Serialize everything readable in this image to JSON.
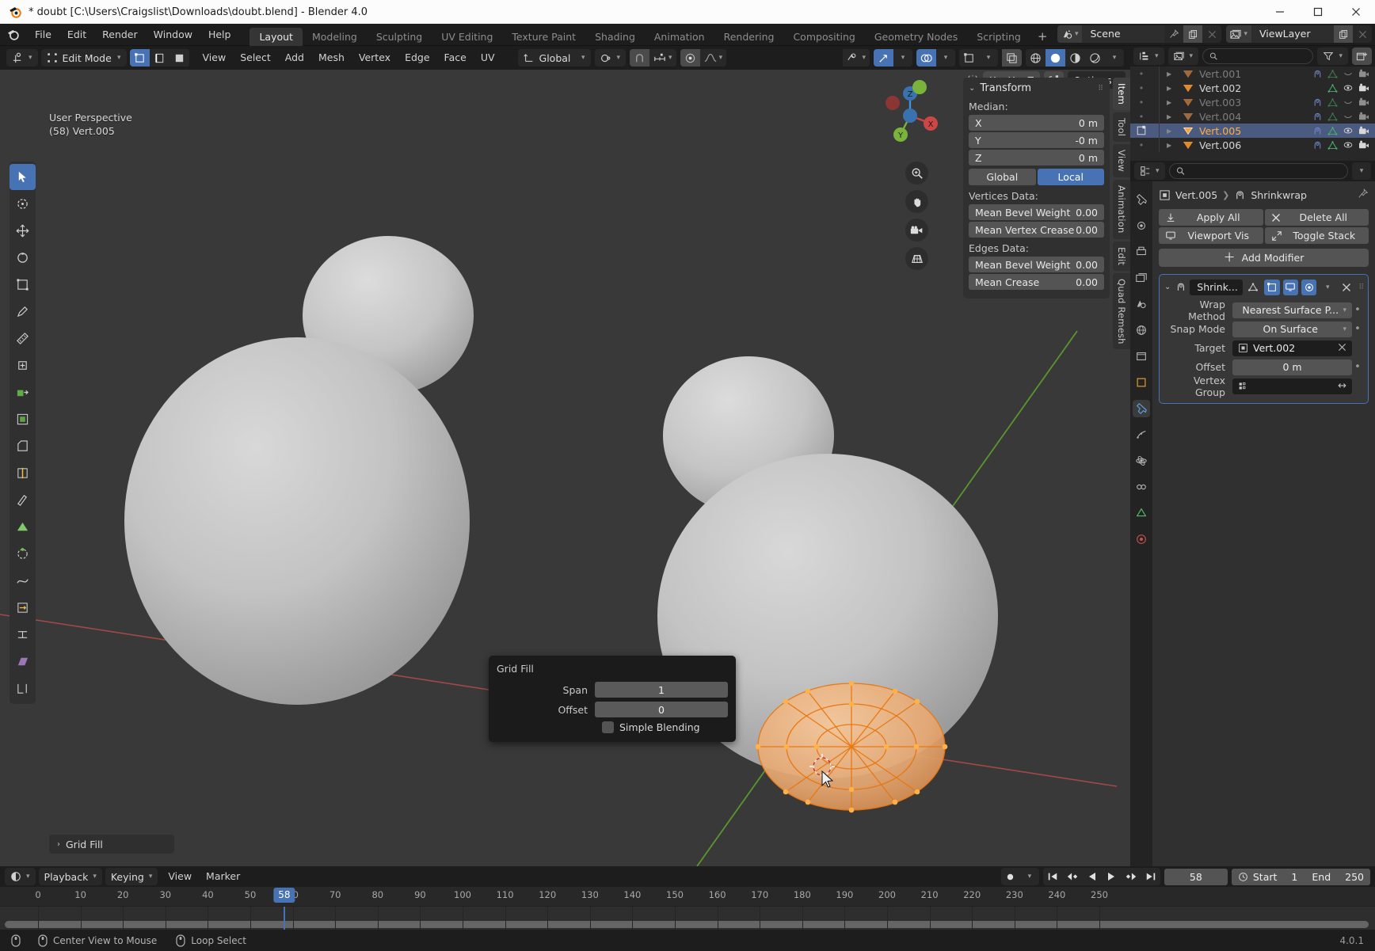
{
  "window": {
    "title": "* doubt [C:\\Users\\Craigslist\\Downloads\\doubt.blend] - Blender 4.0",
    "minimize": "–",
    "maximize": "▢",
    "close": "✕"
  },
  "topbar": {
    "menus": [
      "File",
      "Edit",
      "Render",
      "Window",
      "Help"
    ],
    "workspaces": [
      {
        "label": "Layout",
        "active": true
      },
      {
        "label": "Modeling",
        "active": false
      },
      {
        "label": "Sculpting",
        "active": false
      },
      {
        "label": "UV Editing",
        "active": false
      },
      {
        "label": "Texture Paint",
        "active": false
      },
      {
        "label": "Shading",
        "active": false
      },
      {
        "label": "Animation",
        "active": false
      },
      {
        "label": "Rendering",
        "active": false
      },
      {
        "label": "Compositing",
        "active": false
      },
      {
        "label": "Geometry Nodes",
        "active": false
      },
      {
        "label": "Scripting",
        "active": false
      }
    ],
    "add_workspace": "+",
    "scene_name": "Scene",
    "viewlayer_name": "ViewLayer"
  },
  "viewport": {
    "mode": "Edit Mode",
    "menus": [
      "View",
      "Select",
      "Add",
      "Mesh",
      "Vertex",
      "Edge",
      "Face",
      "UV"
    ],
    "transform_orientation": "Global",
    "options_label": "Options",
    "axis_buttons": [
      "X",
      "Y",
      "Z"
    ],
    "overlay_text_line1": "User Perspective",
    "overlay_text_line2": "(58) Vert.005",
    "gizmo_axes": [
      "X",
      "Y",
      "Z"
    ],
    "operator_panel_label": "Grid Fill"
  },
  "npanel": {
    "tab_active": "Item",
    "tabs": [
      "Item",
      "Tool",
      "View",
      "Animation",
      "Edit",
      "Quad Remesh"
    ],
    "title": "Transform",
    "median_label": "Median:",
    "median": [
      {
        "axis": "X",
        "value": "0 m"
      },
      {
        "axis": "Y",
        "value": "-0 m"
      },
      {
        "axis": "Z",
        "value": "0 m"
      }
    ],
    "space_global": "Global",
    "space_local": "Local",
    "space_active": "Local",
    "vertices_data_label": "Vertices Data:",
    "vertices_data": [
      {
        "label": "Mean Bevel Weight",
        "value": "0.00"
      },
      {
        "label": "Mean Vertex Crease",
        "value": "0.00"
      }
    ],
    "edges_data_label": "Edges Data:",
    "edges_data": [
      {
        "label": "Mean Bevel Weight",
        "value": "0.00"
      },
      {
        "label": "Mean Crease",
        "value": "0.00"
      }
    ]
  },
  "gridfill": {
    "title": "Grid Fill",
    "span_label": "Span",
    "span_value": "1",
    "offset_label": "Offset",
    "offset_value": "0",
    "simple_blending_label": "Simple Blending",
    "simple_blending_checked": false
  },
  "outliner": {
    "search_placeholder": "",
    "rows": [
      {
        "name": "Vert.001",
        "dim": true,
        "selected": false,
        "has_wrench": true,
        "eye": "closed",
        "camera": true
      },
      {
        "name": "Vert.002",
        "dim": false,
        "selected": false,
        "has_wrench": false,
        "eye": "open",
        "camera": true
      },
      {
        "name": "Vert.003",
        "dim": true,
        "selected": false,
        "has_wrench": true,
        "eye": "closed",
        "camera": true
      },
      {
        "name": "Vert.004",
        "dim": true,
        "selected": false,
        "has_wrench": true,
        "eye": "closed",
        "camera": true
      },
      {
        "name": "Vert.005",
        "dim": false,
        "selected": true,
        "has_wrench": true,
        "eye": "open",
        "camera": true
      },
      {
        "name": "Vert.006",
        "dim": false,
        "selected": false,
        "has_wrench": true,
        "eye": "open",
        "camera": true
      }
    ]
  },
  "properties": {
    "search_placeholder": "",
    "breadcrumb_object": "Vert.005",
    "breadcrumb_modifier": "Shrinkwrap",
    "apply_all": "Apply All",
    "delete_all": "Delete All",
    "viewport_vis": "Viewport Vis",
    "toggle_stack": "Toggle Stack",
    "add_modifier": "Add Modifier",
    "modifier": {
      "name": "Shrink...",
      "wrap_method_label": "Wrap Method",
      "wrap_method_value": "Nearest Surface P...",
      "snap_mode_label": "Snap Mode",
      "snap_mode_value": "On Surface",
      "target_label": "Target",
      "target_value": "Vert.002",
      "offset_label": "Offset",
      "offset_value": "0 m",
      "vertex_group_label": "Vertex Group",
      "vertex_group_value": ""
    }
  },
  "timeline": {
    "menus": [
      "View",
      "Marker"
    ],
    "playback": "Playback",
    "keying": "Keying",
    "current_frame": "58",
    "start_label": "Start",
    "start_value": "1",
    "end_label": "End",
    "end_value": "250",
    "ticks": [
      0,
      10,
      20,
      30,
      40,
      50,
      60,
      70,
      80,
      90,
      100,
      110,
      120,
      130,
      140,
      150,
      160,
      170,
      180,
      190,
      200,
      210,
      220,
      230,
      240,
      250
    ]
  },
  "statusbar": {
    "items": [
      "Center View to Mouse",
      "Loop Select"
    ],
    "version": "4.0.1"
  },
  "colors": {
    "accent_blue": "#4772b3",
    "select_orange": "#ffae42",
    "panel_bg": "#303030",
    "editor_bg": "#282828",
    "header_bg": "#1d1d1d",
    "viewport_bg": "#393939"
  }
}
